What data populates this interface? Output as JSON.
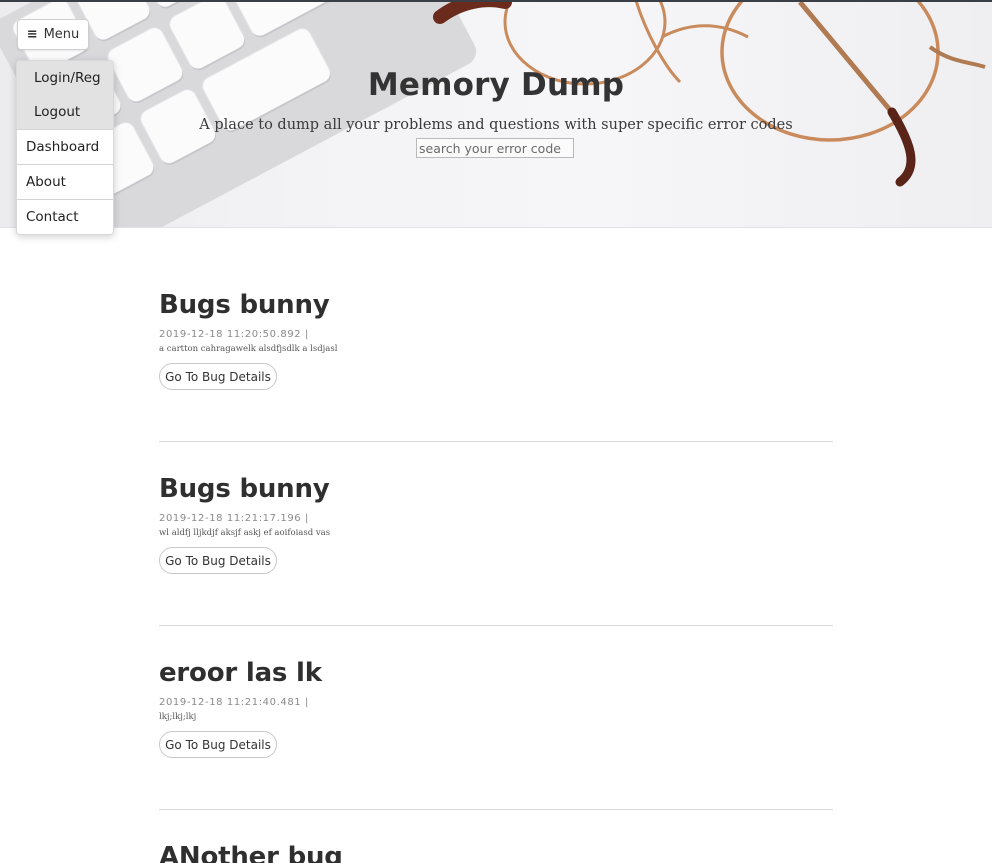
{
  "menu": {
    "label": "Menu",
    "icon": "hamburger-icon",
    "items": [
      {
        "label": "Login/Reg"
      },
      {
        "label": "Logout"
      },
      {
        "label": "Dashboard"
      },
      {
        "label": "About"
      },
      {
        "label": "Contact"
      }
    ]
  },
  "header": {
    "title": "Memory Dump",
    "subtitle": "A place to dump all your problems and questions with super specific error codes",
    "search_placeholder": "search your error code"
  },
  "posts": [
    {
      "title": "Bugs bunny",
      "meta": "2019-12-18 11:20:50.892 |",
      "description": "a cartton cahragawelk alsdfjsdlk a lsdjasl",
      "button": "Go To Bug Details"
    },
    {
      "title": "Bugs bunny",
      "meta": "2019-12-18 11:21:17.196 |",
      "description": "wl aldfj lljkdjf aksjf askj ef aoifoiasd vas",
      "button": "Go To Bug Details"
    },
    {
      "title": "eroor las lk",
      "meta": "2019-12-18 11:21:40.481 |",
      "description": "lkj;lkj;lkj",
      "button": "Go To Bug Details"
    },
    {
      "title": "ANother bug"
    }
  ],
  "colors": {
    "title": "#333333",
    "accent_border": "#3a3f47",
    "divider": "#d9d9d9"
  }
}
